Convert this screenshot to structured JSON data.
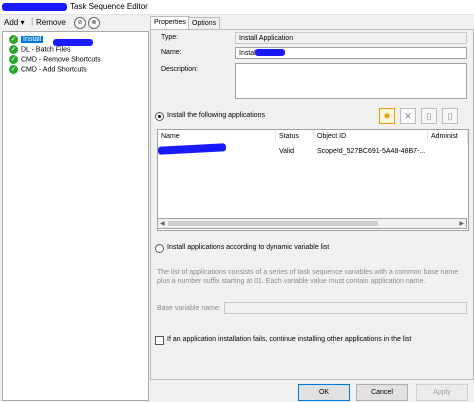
{
  "window": {
    "title": "Task Sequence Editor"
  },
  "toolbar": {
    "add_label": "Add",
    "remove_label": "Remove"
  },
  "tree": {
    "items": [
      {
        "label": "Install",
        "selected": true
      },
      {
        "label": "DL - Batch Files"
      },
      {
        "label": "CMD - Remove Shortcuts"
      },
      {
        "label": "CMD - Add Shortcuts"
      }
    ]
  },
  "tabs": [
    {
      "label": "Properties"
    },
    {
      "label": "Options"
    }
  ],
  "properties": {
    "type_label": "Type:",
    "type_value": "Install Application",
    "name_label": "Name:",
    "name_value": "Install",
    "description_label": "Description:",
    "description_value": ""
  },
  "apps_section": {
    "install_following_label": "Install the following applications",
    "columns": [
      "Name",
      "Status",
      "Object ID",
      "Administ"
    ],
    "rows": [
      {
        "name": "",
        "status": "Valid",
        "object_id": "ScopeId_527BC691-5A48-48B7-..."
      }
    ]
  },
  "dynamic_section": {
    "label": "Install applications according to dynamic variable list",
    "description": "The list of applications consists of a series of task sequence variables with a common base name plus a number suffix starting at 01. Each variable value must contain application name.",
    "base_variable_label": "Base variable name:",
    "base_variable_value": ""
  },
  "continue_on_fail_label": "If an application installation fails, continue installing other applications in the list",
  "buttons": {
    "ok": "OK",
    "cancel": "Cancel",
    "apply": "Apply"
  },
  "colors": {
    "selection": "#0078d7",
    "status_ok": "#2aa52a",
    "redaction": "#1a1aff"
  }
}
